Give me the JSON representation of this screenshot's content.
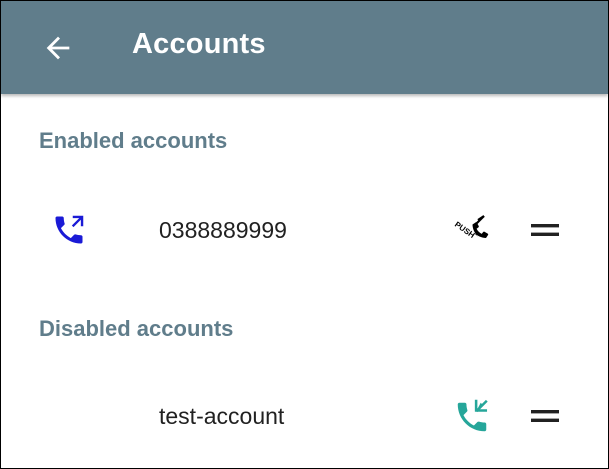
{
  "appbar": {
    "title": "Accounts",
    "back_icon": "arrow-left-icon",
    "background": "#607d8b"
  },
  "sections": {
    "enabled": {
      "header": "Enabled accounts",
      "accounts": [
        {
          "name": "0388889999",
          "type_icon": "phone-outgoing-icon",
          "type_icon_color": "#1a1ad6",
          "status_icon": "push-icon",
          "status_icon_label": "PUSH",
          "handle_icon": "drag-handle-icon"
        }
      ]
    },
    "disabled": {
      "header": "Disabled accounts",
      "accounts": [
        {
          "name": "test-account",
          "status_icon": "phone-incoming-icon",
          "status_icon_color": "#26a69a",
          "handle_icon": "drag-handle-icon"
        }
      ]
    }
  },
  "colors": {
    "accent_header": "#607d8b",
    "text_primary": "#212121"
  }
}
